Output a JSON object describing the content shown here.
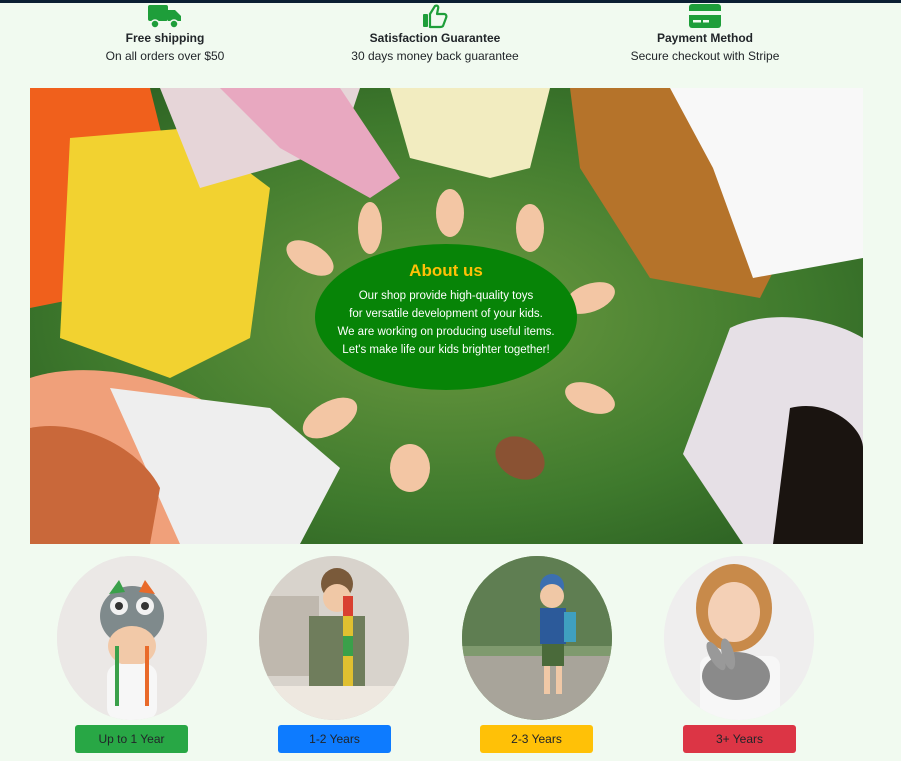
{
  "features": [
    {
      "icon": "truck-icon",
      "title": "Free shipping",
      "subtitle": "On all orders over $50"
    },
    {
      "icon": "thumbs-up-icon",
      "title": "Satisfaction Guarantee",
      "subtitle": "30 days money back guarantee"
    },
    {
      "icon": "credit-card-icon",
      "title": "Payment Method",
      "subtitle": "Secure checkout with Stripe"
    }
  ],
  "about": {
    "title": "About us",
    "lines": [
      "Our shop provide high-quality toys",
      "for versatile development of your kids.",
      "We are working on producing useful items.",
      "Let's make life our kids brighter together!"
    ]
  },
  "ages": [
    {
      "label": "Up to 1 Year",
      "color": "#28a745"
    },
    {
      "label": "1-2 Years",
      "color": "#0d7bff"
    },
    {
      "label": "2-3 Years",
      "color": "#ffc107"
    },
    {
      "label": "3+ Years",
      "color": "#dc3545"
    }
  ],
  "colors": {
    "accent_green": "#1e9e3a",
    "about_bg": "#078407",
    "about_title": "#ffc107",
    "page_bg": "#f1faf0"
  }
}
